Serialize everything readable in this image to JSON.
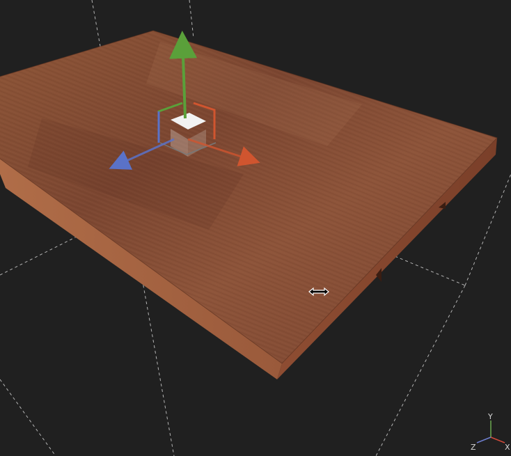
{
  "viewport": {
    "background": "#202020",
    "guide_line_color": "#cfcfcf"
  },
  "board": {
    "top_color": "#8a4f33",
    "side_color": "#a7653f",
    "edge_dark": "#5f3220"
  },
  "gizmo": {
    "x_axis_color": "#d0552f",
    "y_axis_color": "#5aa03a",
    "z_axis_color": "#5a72c8",
    "center_color": "#f2f2f2"
  },
  "cursor": {
    "icon": "horizontal-resize-cursor-icon"
  },
  "orientation_axes": {
    "labels": {
      "x": "X",
      "y": "Y",
      "z": "Z"
    },
    "colors": {
      "x": "#d24a3a",
      "y": "#6aa84f",
      "z": "#6f7fcf"
    }
  }
}
